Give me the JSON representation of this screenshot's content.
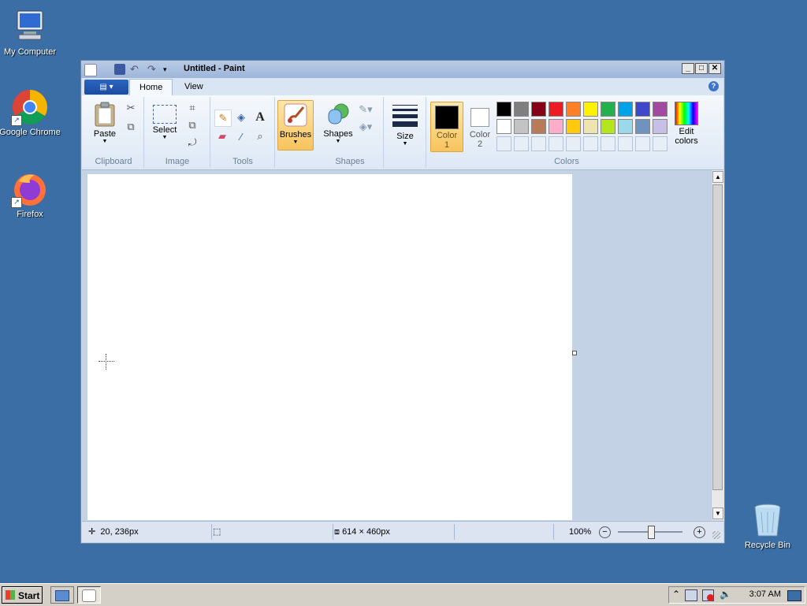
{
  "desktop": {
    "icons": [
      {
        "label": "My Computer"
      },
      {
        "label": "Google Chrome"
      },
      {
        "label": "Firefox"
      },
      {
        "label": "Recycle Bin"
      }
    ]
  },
  "window": {
    "title": "Untitled - Paint",
    "tabs": [
      {
        "label": "Home"
      },
      {
        "label": "View"
      }
    ],
    "ribbon": {
      "clipboard": {
        "paste": "Paste",
        "group_label": "Clipboard"
      },
      "image": {
        "select": "Select",
        "group_label": "Image"
      },
      "tools": {
        "group_label": "Tools"
      },
      "brushes": {
        "label": "Brushes"
      },
      "shapes": {
        "label": "Shapes",
        "group_label": "Shapes"
      },
      "size": {
        "label": "Size"
      },
      "colors": {
        "color1": "Color\n1",
        "color1_l1": "Color",
        "color1_l2": "1",
        "color2_l1": "Color",
        "color2_l2": "2",
        "edit_l1": "Edit",
        "edit_l2": "colors",
        "group_label": "Colors",
        "color1_value": "#000000",
        "color2_value": "#ffffff",
        "palette_row1": [
          "#000000",
          "#7f7f7f",
          "#880015",
          "#ed1c24",
          "#ff7f27",
          "#fff200",
          "#22b14c",
          "#00a2e8",
          "#3f48cc",
          "#a349a4"
        ],
        "palette_row2": [
          "#ffffff",
          "#c3c3c3",
          "#b97a57",
          "#ffaec9",
          "#ffc90e",
          "#efe4b0",
          "#b5e61d",
          "#99d9ea",
          "#7092be",
          "#c8bfe7"
        ],
        "palette_row3": [
          "#e8eef6",
          "#e8eef6",
          "#e8eef6",
          "#e8eef6",
          "#e8eef6",
          "#e8eef6",
          "#e8eef6",
          "#e8eef6",
          "#e8eef6",
          "#e8eef6"
        ]
      }
    },
    "status": {
      "cursor_pos": "20, 236px",
      "selection_size": "",
      "canvas_size": "614 × 460px",
      "zoom": "100%"
    }
  },
  "taskbar": {
    "start_label": "Start",
    "clock": "3:07 AM"
  }
}
